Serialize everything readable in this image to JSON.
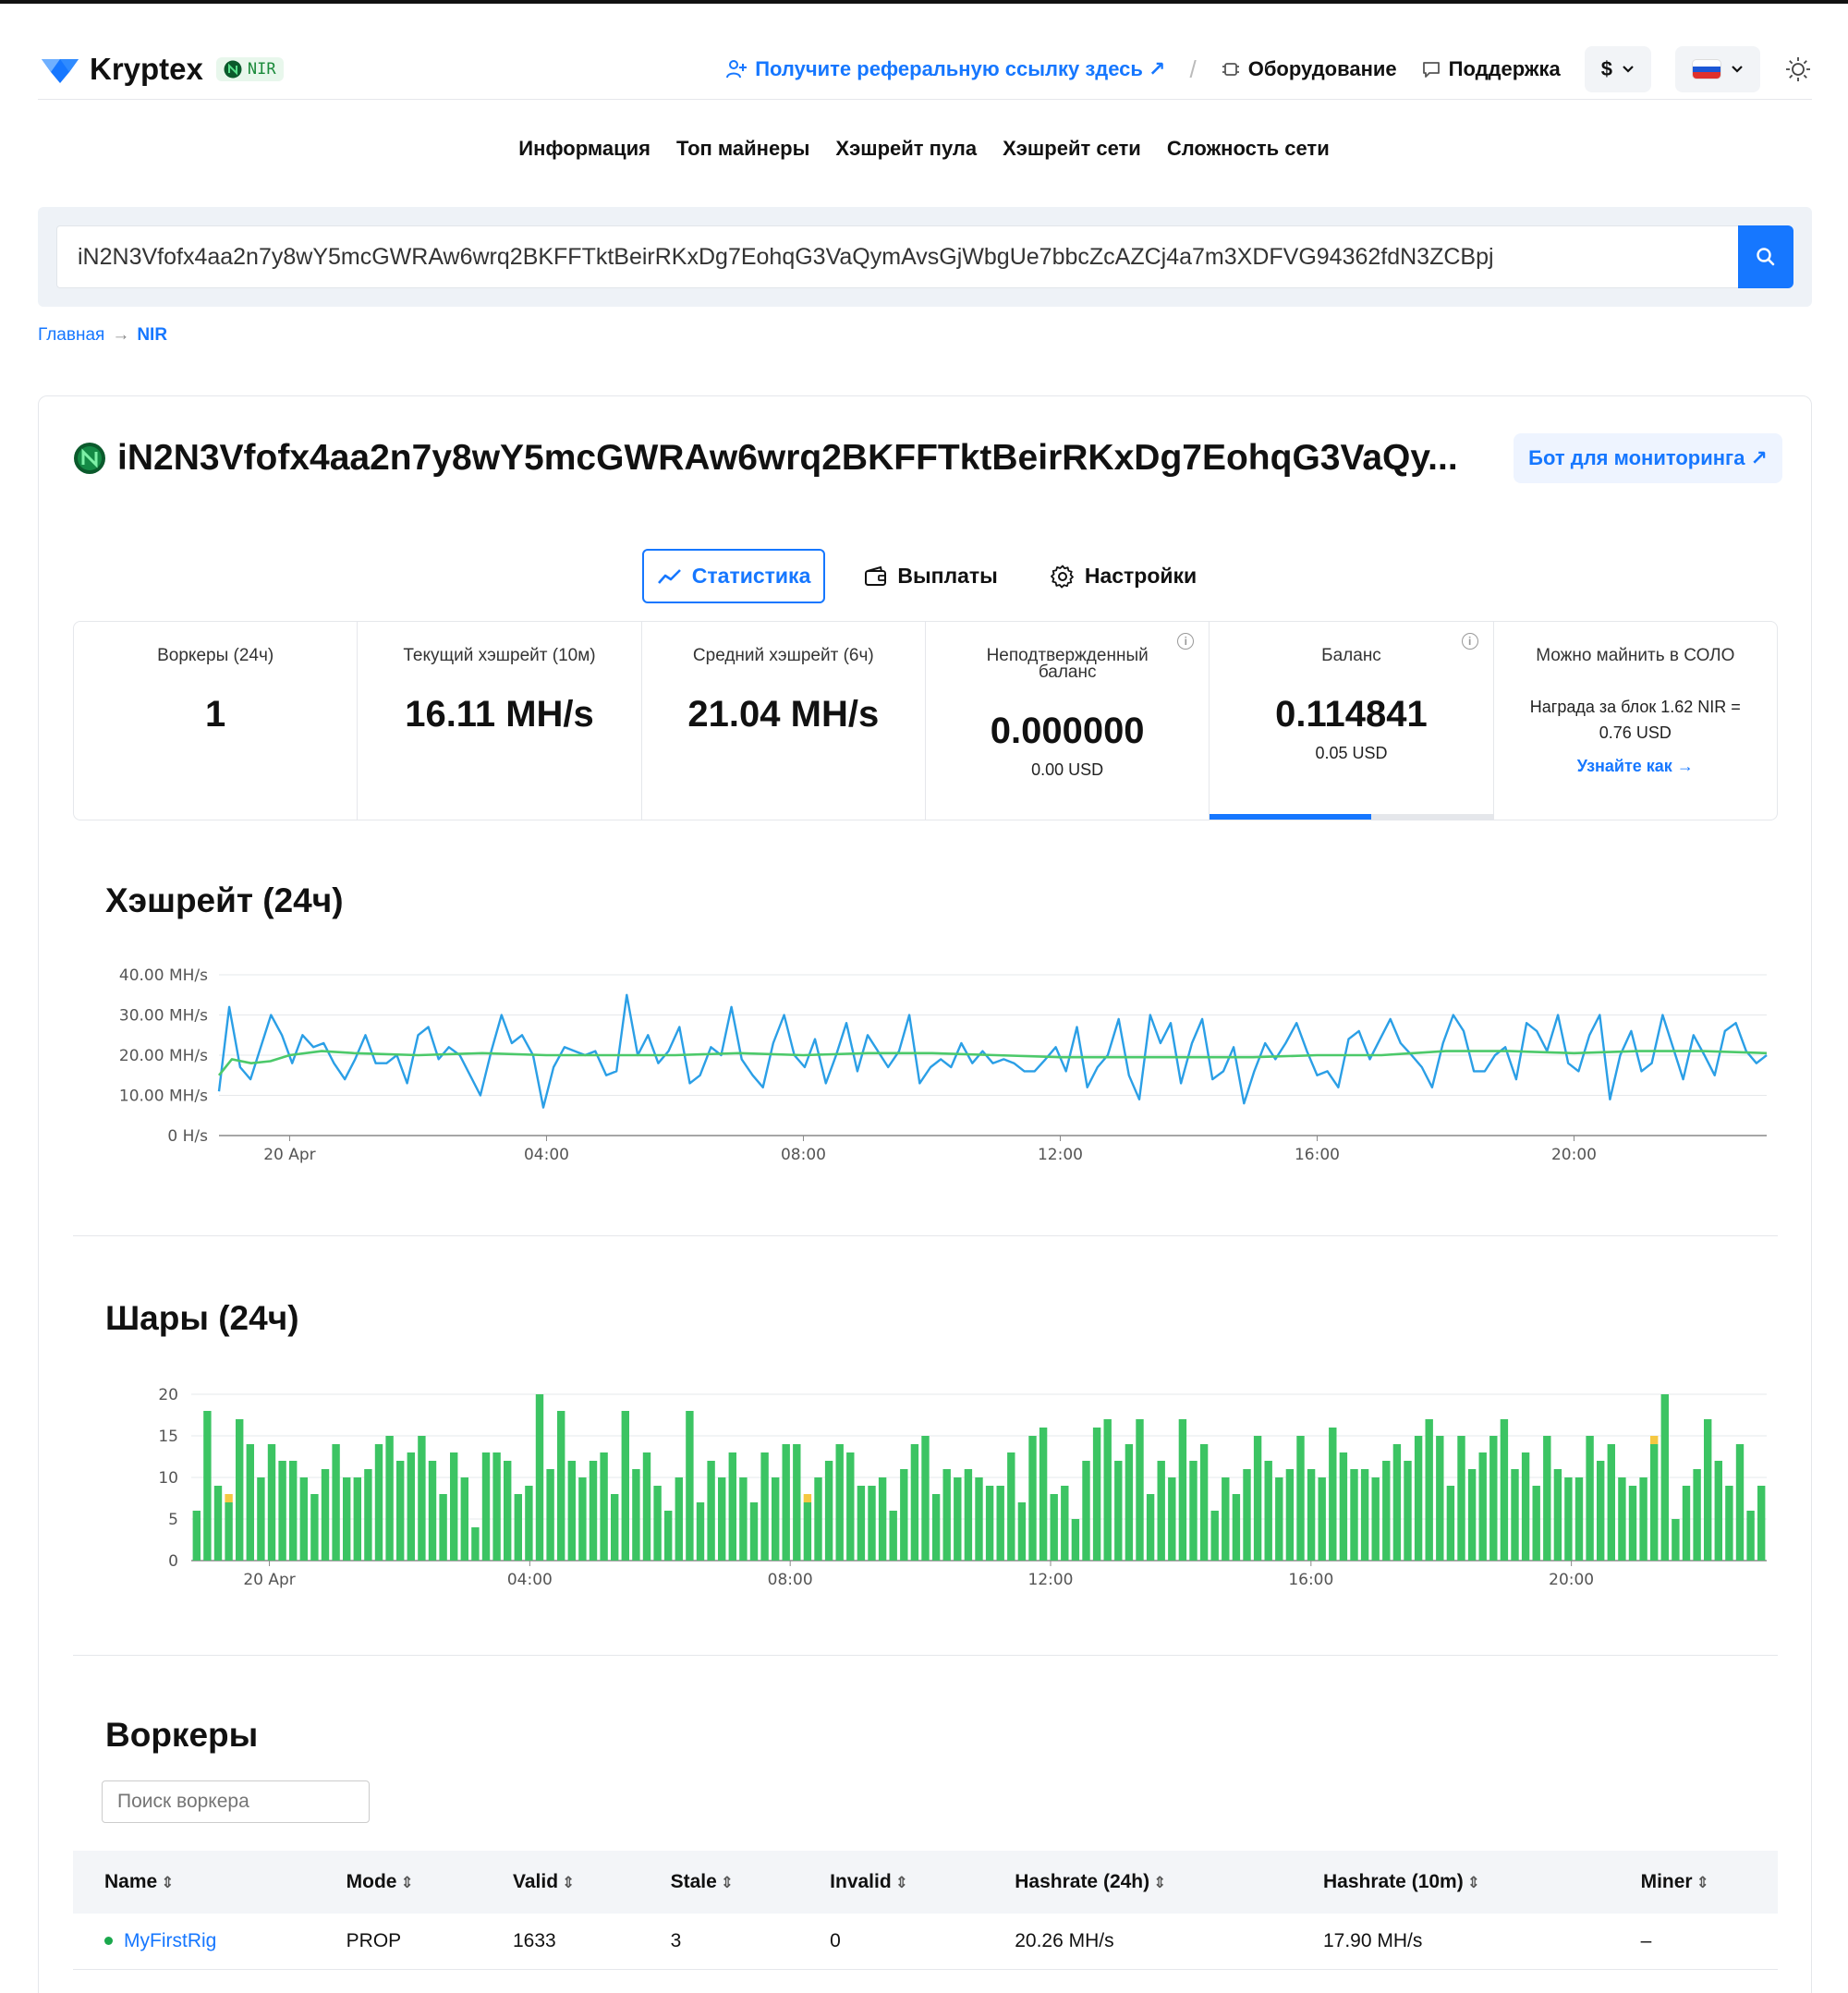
{
  "header": {
    "brand": "Kryptex",
    "coin_badge": "NIR",
    "referral_link": "Получите реферальную ссылку здесь ↗",
    "separator": "/",
    "equipment": "Оборудование",
    "support": "Поддержка",
    "currency": "$"
  },
  "subnav": [
    "Информация",
    "Топ майнеры",
    "Хэшрейт пула",
    "Хэшрейт сети",
    "Сложность сети"
  ],
  "search": {
    "value": "iN2N3Vfofx4aa2n7y8wY5mcGWRAw6wrq2BKFFTktBeirRKxDg7EohqG3VaQymAvsGjWbgUe7bbcZcAZCj4a7m3XDFVG94362fdN3ZCBpj"
  },
  "breadcrumb": {
    "home": "Главная",
    "arrow": "→",
    "current": "NIR"
  },
  "wallet": {
    "title": "iN2N3Vfofx4aa2n7y8wY5mcGWRAw6wrq2BKFFTktBeirRKxDg7EohqG3VaQy...",
    "bot_button": "Бот для мониторинга ↗"
  },
  "tabs": [
    {
      "label": "Статистика",
      "active": true
    },
    {
      "label": "Выплаты",
      "active": false
    },
    {
      "label": "Настройки",
      "active": false
    }
  ],
  "stats": {
    "workers": {
      "label": "Воркеры (24ч)",
      "value": "1"
    },
    "current_hashrate": {
      "label": "Текущий хэшрейт (10м)",
      "value": "16.11 MH/s"
    },
    "avg_hashrate": {
      "label": "Средний хэшрейт (6ч)",
      "value": "21.04 MH/s"
    },
    "unconfirmed": {
      "label_line1": "Неподтвержденный",
      "label_line2": "баланс",
      "value": "0.000000",
      "sub": "0.00 USD",
      "info": "i"
    },
    "balance": {
      "label": "Баланс",
      "value": "0.114841",
      "sub": "0.05 USD",
      "info": "i",
      "progress": 0.57
    },
    "solo": {
      "label": "Можно майнить в СОЛО",
      "line1": "Награда за блок 1.62 NIR =",
      "line2": "0.76 USD",
      "link": "Узнайте как →"
    }
  },
  "hashrate_section_title": "Хэшрейт (24ч)",
  "shares_section_title": "Шары (24ч)",
  "workers_section": {
    "title": "Воркеры",
    "search_placeholder": "Поиск воркера",
    "columns": [
      "Name",
      "Mode",
      "Valid",
      "Stale",
      "Invalid",
      "Hashrate (24h)",
      "Hashrate (10m)",
      "Miner"
    ],
    "sort_icon": "⇕",
    "rows": [
      {
        "name": "MyFirstRig",
        "mode": "PROP",
        "valid": "1633",
        "stale": "3",
        "invalid": "0",
        "hashrate_24h": "20.26 MH/s",
        "hashrate_10m": "17.90 MH/s",
        "miner": "–"
      }
    ]
  },
  "colors": {
    "accent": "#1677ff",
    "hashrate_line": "#2b9fe6",
    "average_line": "#4cc96a",
    "valid_shares": "#3cc463",
    "stale_shares": "#f5c842",
    "russia_flag": [
      "#ffffff",
      "#1c57d6",
      "#e0312c"
    ]
  },
  "chart_data": [
    {
      "type": "line",
      "title": "Хэшрейт (24ч)",
      "y_unit": "MH/s",
      "y_ticks": [
        "0 H/s",
        "10.00 MH/s",
        "20.00 MH/s",
        "30.00 MH/s",
        "40.00 MH/s"
      ],
      "ylim": [
        0,
        40
      ],
      "x_ticks": [
        "20 Apr",
        "04:00",
        "08:00",
        "12:00",
        "16:00",
        "20:00"
      ],
      "x_range_hours": [
        -1.1,
        23.0
      ],
      "x_tick_hours": [
        0,
        4,
        8,
        12,
        16,
        20
      ],
      "grid": true,
      "series": [
        {
          "role": "hashrate",
          "x_hours": [
            -1.1,
            -0.94,
            -0.77,
            -0.61,
            -0.45,
            -0.29,
            -0.12,
            0.04,
            0.2,
            0.37,
            0.53,
            0.69,
            0.86,
            1.02,
            1.18,
            1.34,
            1.51,
            1.67,
            1.83,
            2.0,
            2.16,
            2.32,
            2.48,
            2.65,
            2.81,
            2.97,
            3.14,
            3.3,
            3.46,
            3.62,
            3.79,
            3.95,
            4.11,
            4.28,
            4.44,
            4.6,
            4.76,
            4.93,
            5.09,
            5.25,
            5.42,
            5.58,
            5.74,
            5.9,
            6.07,
            6.23,
            6.39,
            6.56,
            6.72,
            6.88,
            7.04,
            7.21,
            7.37,
            7.53,
            7.7,
            7.86,
            8.02,
            8.18,
            8.35,
            8.51,
            8.67,
            8.84,
            9.0,
            9.16,
            9.32,
            9.49,
            9.65,
            9.81,
            9.98,
            10.14,
            10.3,
            10.46,
            10.63,
            10.79,
            10.95,
            11.12,
            11.28,
            11.44,
            11.6,
            11.77,
            11.93,
            12.09,
            12.26,
            12.42,
            12.58,
            12.74,
            12.91,
            13.07,
            13.23,
            13.4,
            13.56,
            13.72,
            13.88,
            14.05,
            14.21,
            14.37,
            14.54,
            14.7,
            14.86,
            15.02,
            15.19,
            15.35,
            15.51,
            15.68,
            15.84,
            16.0,
            16.16,
            16.33,
            16.49,
            16.65,
            16.82,
            16.98,
            17.14,
            17.3,
            17.47,
            17.63,
            17.79,
            17.96,
            18.12,
            18.28,
            18.44,
            18.61,
            18.77,
            18.93,
            19.1,
            19.26,
            19.42,
            19.58,
            19.75,
            19.91,
            20.07,
            20.24,
            20.4,
            20.56,
            20.72,
            20.89,
            21.05,
            21.21,
            21.38,
            21.54,
            21.7,
            21.86,
            22.03,
            22.19,
            22.35,
            22.52,
            22.68,
            22.84,
            23.0
          ],
          "values": [
            11,
            32,
            17,
            14,
            22,
            30,
            25,
            18,
            25,
            22,
            23,
            18,
            14,
            19,
            25,
            18,
            18,
            20,
            13,
            25,
            27,
            19,
            22,
            20,
            15,
            10,
            21,
            30,
            23,
            25,
            20,
            7,
            17,
            22,
            21,
            20,
            21,
            15,
            16,
            35,
            20,
            25,
            18,
            21,
            27,
            13,
            15,
            22,
            20,
            32,
            19,
            15,
            12,
            23,
            30,
            20,
            17,
            24,
            13,
            20,
            28,
            16,
            25,
            21,
            17,
            21,
            30,
            13,
            17,
            19,
            17,
            23,
            18,
            21,
            18,
            19,
            18,
            16,
            16,
            19,
            22,
            16,
            27,
            12,
            17,
            20,
            29,
            15,
            9,
            30,
            23,
            28,
            13,
            23,
            29,
            14,
            16,
            22,
            8,
            16,
            23,
            19,
            23,
            28,
            21,
            15,
            16,
            12,
            24,
            26,
            19,
            24,
            29,
            23,
            20,
            17,
            12,
            23,
            30,
            26,
            16,
            16,
            20,
            22,
            14,
            28,
            26,
            21,
            30,
            18,
            16,
            25,
            30,
            9,
            20,
            26,
            16,
            18,
            30,
            22,
            14,
            25,
            20,
            15,
            26,
            28,
            21,
            18,
            20,
            14,
            36,
            9,
            15,
            20,
            13,
            30,
            24,
            22,
            28,
            12,
            16,
            22,
            11,
            18,
            24
          ]
        },
        {
          "role": "average",
          "x_hours": [
            -1.1,
            -0.9,
            -0.6,
            -0.3,
            0.0,
            0.5,
            1.0,
            2.0,
            3.0,
            4.0,
            5.0,
            6.0,
            7.0,
            8.0,
            9.0,
            10.0,
            11.0,
            12.0,
            13.0,
            14.0,
            15.0,
            16.0,
            17.0,
            18.0,
            19.0,
            20.0,
            21.0,
            22.0,
            23.0
          ],
          "values": [
            15,
            19,
            18,
            18.5,
            20,
            21,
            20.5,
            20,
            20.5,
            20,
            20,
            20,
            20.5,
            20,
            20.5,
            20.5,
            20,
            19.5,
            19.5,
            19.5,
            19.5,
            20,
            20,
            21,
            21,
            20.5,
            21,
            21,
            20.5
          ]
        }
      ]
    },
    {
      "type": "bar",
      "title": "Шары (24ч)",
      "y_ticks": [
        "0",
        "5",
        "10",
        "15",
        "20"
      ],
      "ylim": [
        0,
        20
      ],
      "x_ticks": [
        "20 Apr",
        "04:00",
        "08:00",
        "12:00",
        "16:00",
        "20:00"
      ],
      "x_range_hours": [
        -1.2,
        23.0
      ],
      "x_tick_hours": [
        0,
        4,
        8,
        12,
        16,
        20
      ],
      "grid": true,
      "series": [
        {
          "name": "valid",
          "values": [
            6,
            18,
            9,
            7,
            17,
            14,
            10,
            14,
            12,
            12,
            10,
            8,
            11,
            14,
            10,
            10,
            11,
            14,
            15,
            12,
            13,
            15,
            12,
            8,
            13,
            10,
            4,
            13,
            13,
            12,
            8,
            9,
            20,
            11,
            18,
            12,
            10,
            12,
            13,
            8,
            18,
            11,
            13,
            9,
            6,
            10,
            18,
            7,
            12,
            10,
            13,
            10,
            7,
            13,
            10,
            14,
            14,
            7,
            10,
            12,
            14,
            13,
            9,
            9,
            10,
            6,
            11,
            14,
            15,
            8,
            11,
            10,
            11,
            10,
            9,
            9,
            13,
            7,
            15,
            16,
            8,
            9,
            5,
            12,
            16,
            17,
            12,
            14,
            17,
            8,
            12,
            10,
            17,
            12,
            14,
            6,
            10,
            8,
            11,
            15,
            12,
            10,
            11,
            15,
            11,
            10,
            16,
            13,
            11,
            11,
            10,
            12,
            14,
            12,
            15,
            17,
            15,
            9,
            15,
            11,
            13,
            15,
            17,
            11,
            13,
            9,
            15,
            11,
            10,
            10,
            15,
            12,
            14,
            10,
            9,
            10,
            14,
            20,
            5,
            9,
            11,
            17,
            12,
            9,
            14,
            6,
            9
          ],
          "color": "#3cc463"
        },
        {
          "name": "stale",
          "values": [
            0,
            0,
            0,
            1,
            0,
            0,
            0,
            0,
            0,
            0,
            0,
            0,
            0,
            0,
            0,
            0,
            0,
            0,
            0,
            0,
            0,
            0,
            0,
            0,
            0,
            0,
            0,
            0,
            0,
            0,
            0,
            0,
            0,
            0,
            0,
            0,
            0,
            0,
            0,
            0,
            0,
            0,
            0,
            0,
            0,
            0,
            0,
            0,
            0,
            0,
            0,
            0,
            0,
            0,
            0,
            0,
            0,
            1,
            0,
            0,
            0,
            0,
            0,
            0,
            0,
            0,
            0,
            0,
            0,
            0,
            0,
            0,
            0,
            0,
            0,
            0,
            0,
            0,
            0,
            0,
            0,
            0,
            0,
            0,
            0,
            0,
            0,
            0,
            0,
            0,
            0,
            0,
            0,
            0,
            0,
            0,
            0,
            0,
            0,
            0,
            0,
            0,
            0,
            0,
            0,
            0,
            0,
            0,
            0,
            0,
            0,
            0,
            0,
            0,
            0,
            0,
            0,
            0,
            0,
            0,
            0,
            0,
            0,
            0,
            0,
            0,
            0,
            0,
            0,
            0,
            0,
            0,
            0,
            0,
            0,
            0,
            1,
            0,
            0,
            0,
            0,
            0,
            0,
            0,
            0,
            0,
            0
          ],
          "color": "#f5c842"
        }
      ]
    }
  ]
}
